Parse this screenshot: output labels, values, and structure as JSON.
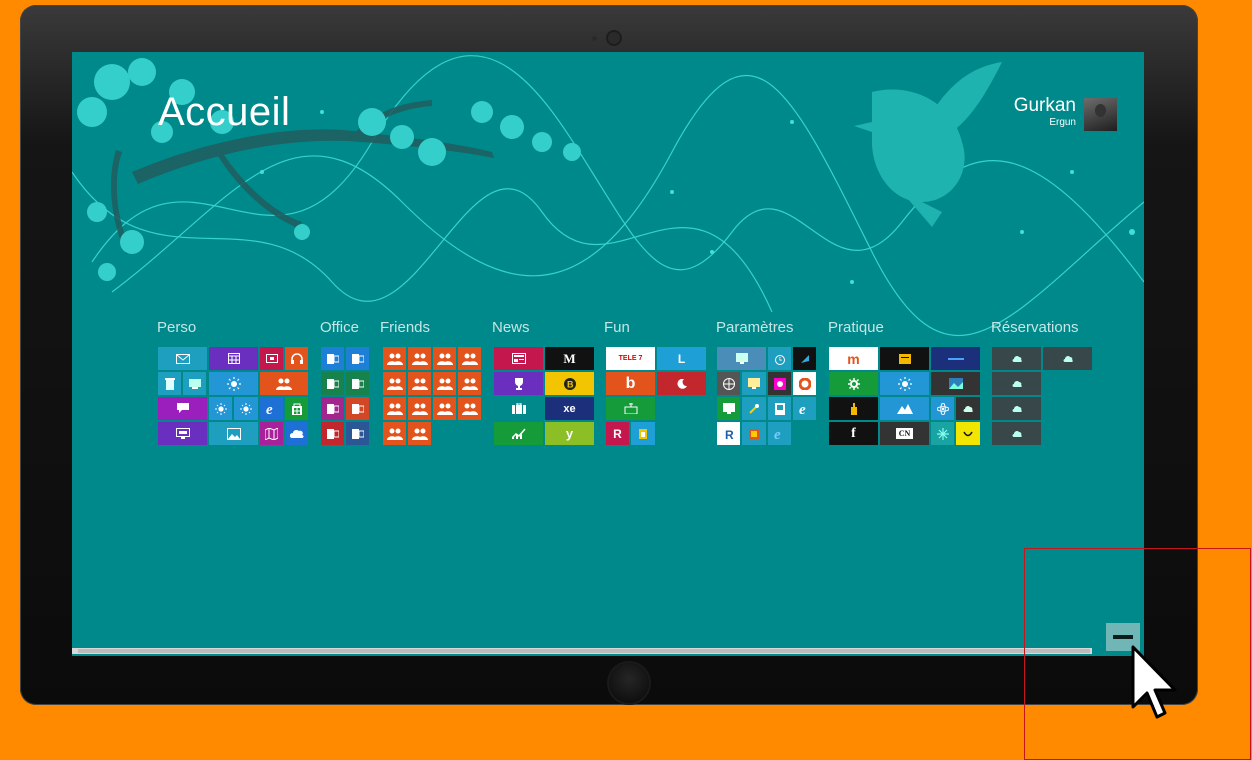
{
  "screen": {
    "title": "Accueil",
    "user": {
      "first_name": "Gurkan",
      "last_name": "Ergun"
    }
  },
  "colors": {
    "background": "#FF8A00",
    "screen": "#00898A",
    "accent_light": "#38D6D2",
    "highlight_box": "#C4161C"
  },
  "groups": [
    {
      "label": "Perso"
    },
    {
      "label": "Office"
    },
    {
      "label": "Friends"
    },
    {
      "label": "News"
    },
    {
      "label": "Fun"
    },
    {
      "label": "Paramètres"
    },
    {
      "label": "Pratique"
    },
    {
      "label": "Réservations"
    }
  ],
  "tiles": {
    "fun_tv_label": "TELE 7",
    "fun_l_label": "L",
    "fun_b_label": "b",
    "fun_r_label": "R",
    "news_xe_label": "xe",
    "news_y_label": "y",
    "news_m_label": "M",
    "pratique_m_label": "m",
    "pratique_f_label": "f",
    "pratique_cn_label": "CN",
    "param_r_label": "R",
    "param_e_label": "e"
  },
  "icons": {
    "zoom_button": "minus-icon",
    "cursor": "mouse-pointer-icon",
    "tile_icons": [
      "mail-icon",
      "calendar-icon",
      "video-icon",
      "headphones-icon",
      "people-icon",
      "weather-icon",
      "ie-icon",
      "store-icon",
      "photos-icon",
      "maps-icon",
      "skydrive-icon",
      "office-icon",
      "news-icon",
      "trophy-icon",
      "briefcase-icon",
      "chart-icon",
      "cloud-icon"
    ]
  }
}
